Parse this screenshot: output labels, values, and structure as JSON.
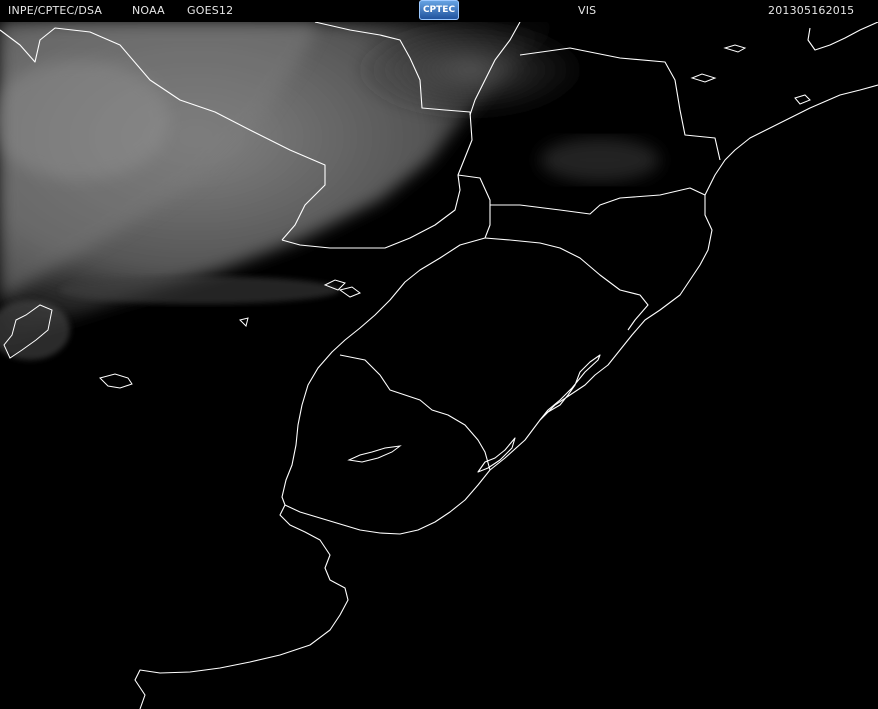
{
  "header": {
    "agency": "INPE/CPTEC/DSA",
    "source": "NOAA",
    "satellite": "GOES12",
    "logo_text": "CPTEC",
    "channel": "VIS",
    "timestamp": "201305162015"
  },
  "colors": {
    "background": "#000000",
    "coastline": "#ffffff",
    "cloud": "#6e6e6e",
    "header_text": "#e6e6e6"
  }
}
